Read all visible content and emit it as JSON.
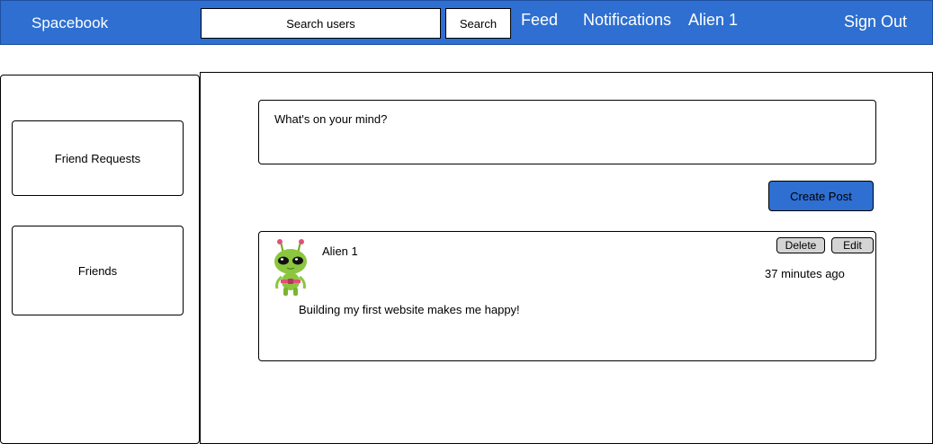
{
  "header": {
    "brand": "Spacebook",
    "search_placeholder": "Search users",
    "search_button": "Search",
    "nav": {
      "feed": "Feed",
      "notifications": "Notifications",
      "profile": "Alien 1",
      "sign_out": "Sign Out"
    }
  },
  "sidebar": {
    "friend_requests": "Friend Requests",
    "friends": "Friends"
  },
  "composer": {
    "placeholder": "What's on your mind?",
    "create_button": "Create Post"
  },
  "posts": [
    {
      "author": "Alien 1",
      "time": "37 minutes ago",
      "body": "Building my first website makes me happy!",
      "avatar_icon": "alien-avatar-icon",
      "delete_label": "Delete",
      "edit_label": "Edit"
    }
  ],
  "colors": {
    "accent": "#2e6fd1",
    "secondary_button": "#d4d4d4"
  }
}
